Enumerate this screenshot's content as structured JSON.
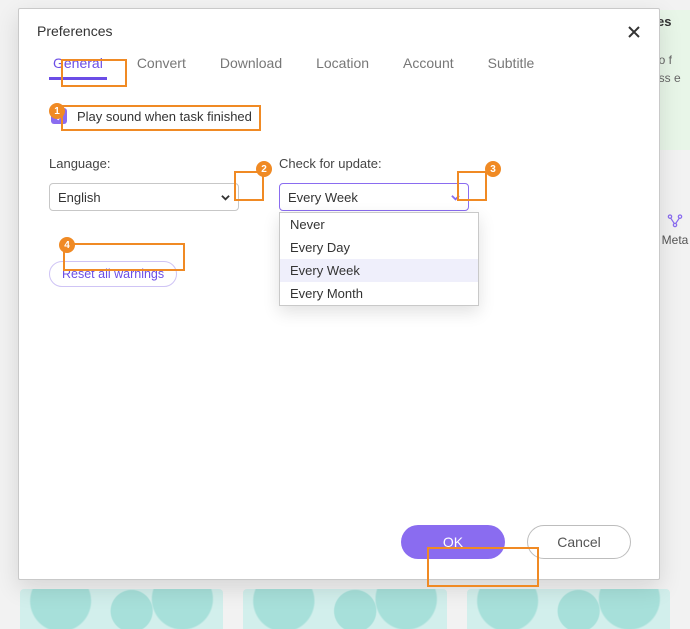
{
  "dialog": {
    "title": "Preferences"
  },
  "tabs": {
    "general": "General",
    "convert": "Convert",
    "download": "Download",
    "location": "Location",
    "account": "Account",
    "subtitle": "Subtitle"
  },
  "general": {
    "play_sound_label": "Play sound when task finished",
    "language_label": "Language:",
    "language_value": "English",
    "update_label": "Check for update:",
    "update_value": "Every Week",
    "update_options": {
      "never": "Never",
      "every_day": "Every Day",
      "every_week": "Every Week",
      "every_month": "Every Month"
    },
    "reset_label": "Reset all warnings"
  },
  "footer": {
    "ok": "OK",
    "cancel": "Cancel"
  },
  "annotations": {
    "n1": "1",
    "n2": "2",
    "n3": "3",
    "n4": "4"
  },
  "bg": {
    "meta": "Meta",
    "res": "res",
    "s": "s",
    "eof": "eo f",
    "oss": "oss e"
  }
}
